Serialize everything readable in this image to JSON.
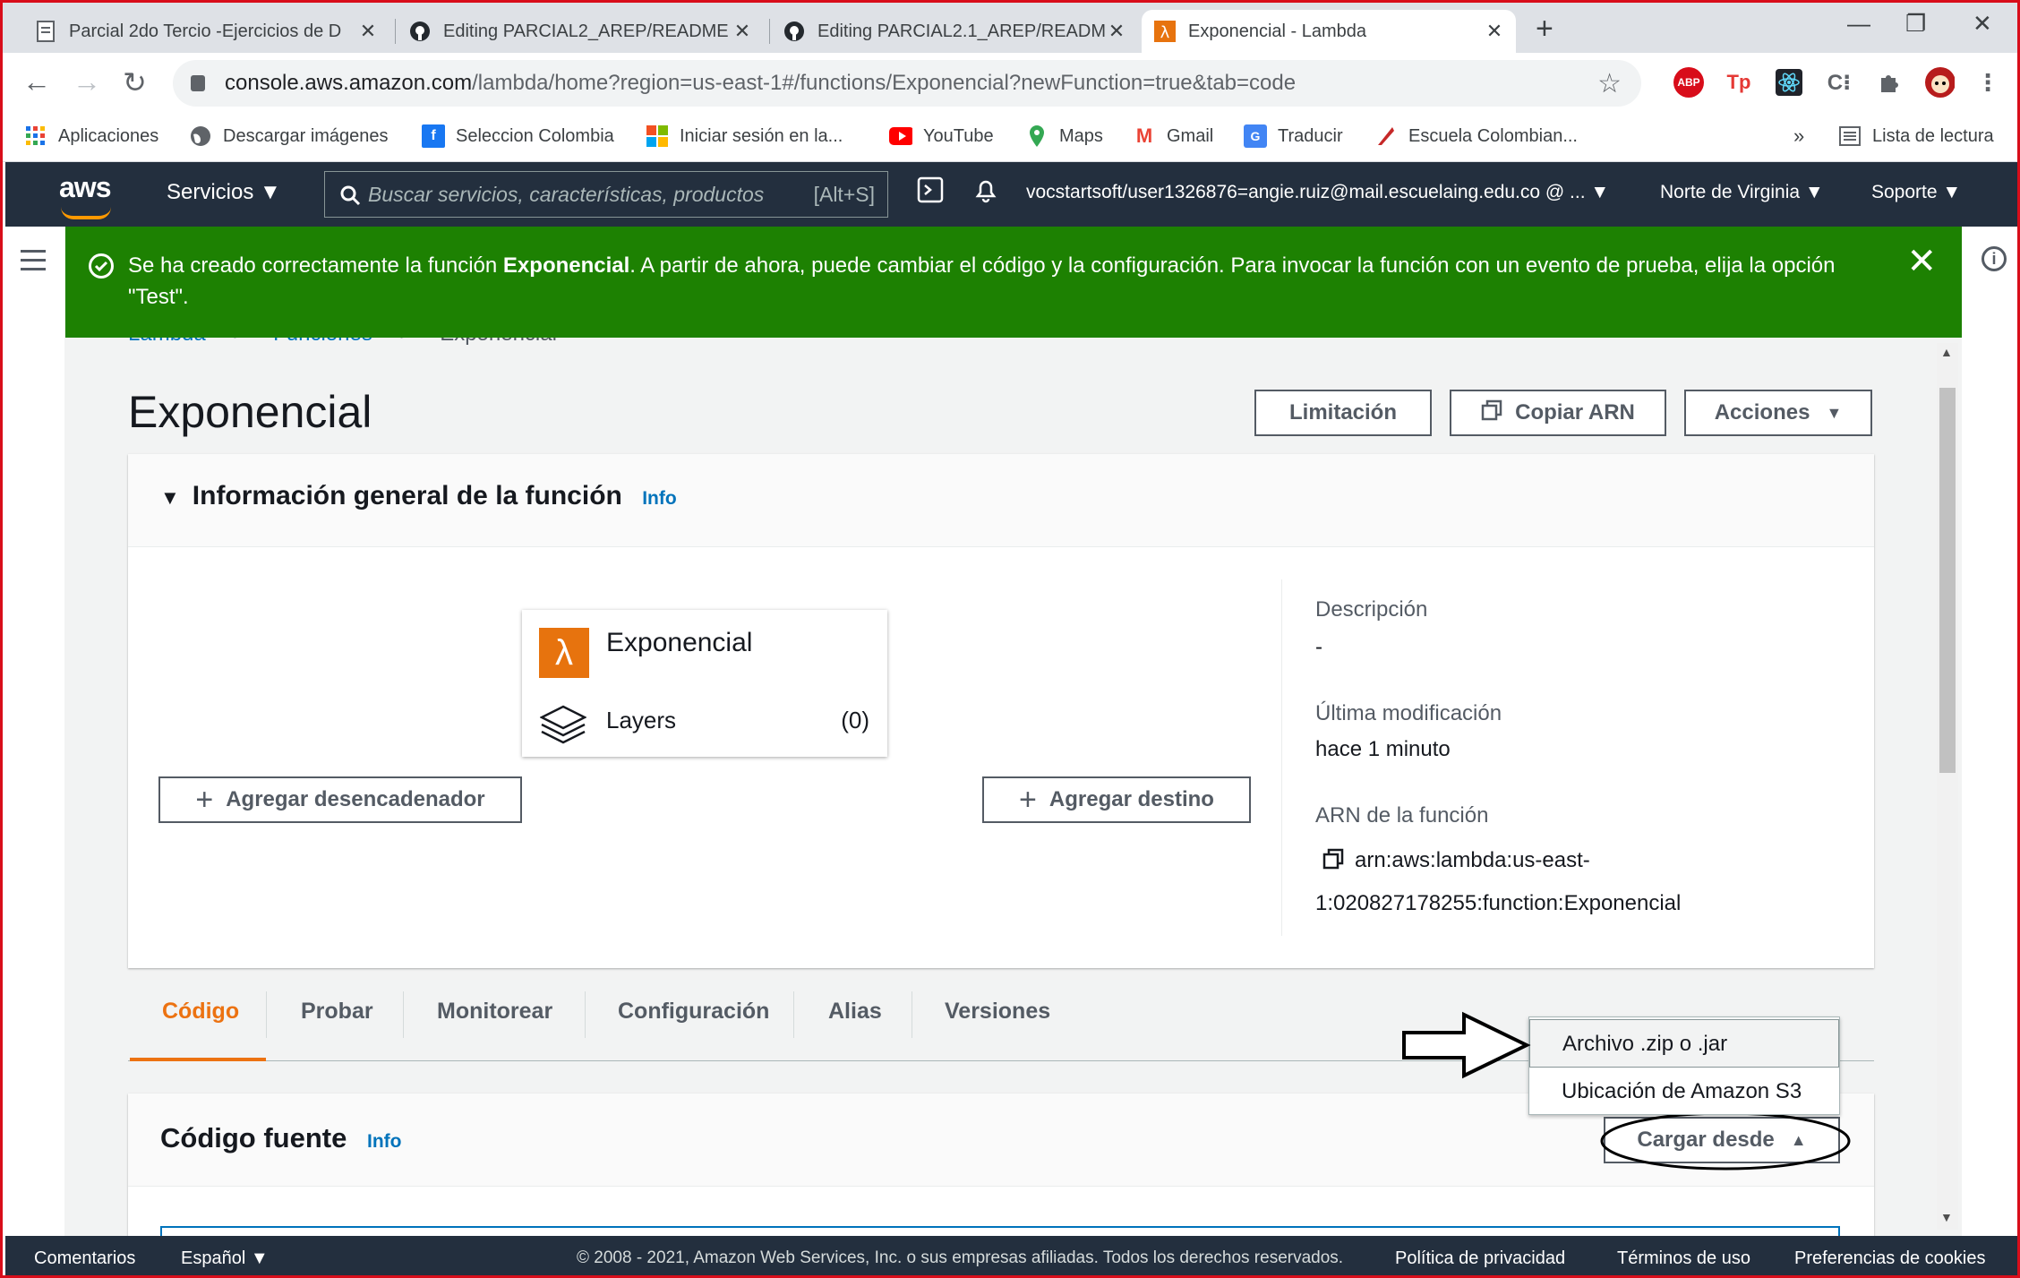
{
  "browser": {
    "tabs": [
      {
        "title": "Parcial 2do Tercio -Ejercicios de D",
        "icon": "document-icon"
      },
      {
        "title": "Editing PARCIAL2_AREP/README",
        "icon": "github-icon"
      },
      {
        "title": "Editing PARCIAL2.1_AREP/READM",
        "icon": "github-icon"
      },
      {
        "title": "Exponencial - Lambda",
        "icon": "lambda-icon"
      }
    ],
    "url_host": "console.aws.amazon.com",
    "url_path": "/lambda/home?region=us-east-1#/functions/Exponencial?newFunction=true&tab=code",
    "extensions": [
      "ABP",
      "Tp"
    ],
    "bookmarks": [
      {
        "label": "Aplicaciones",
        "icon": "apps-grid-icon"
      },
      {
        "label": "Descargar imágenes",
        "icon": "globe-icon"
      },
      {
        "label": "Seleccion Colombia",
        "icon": "facebook-icon"
      },
      {
        "label": "Iniciar sesión en la...",
        "icon": "microsoft-icon"
      },
      {
        "label": "YouTube",
        "icon": "youtube-icon"
      },
      {
        "label": "Maps",
        "icon": "maps-pin-icon"
      },
      {
        "label": "Gmail",
        "icon": "gmail-icon"
      },
      {
        "label": "Traducir",
        "icon": "translate-icon"
      },
      {
        "label": "Escuela Colombian...",
        "icon": "school-icon"
      }
    ],
    "bookmarks_overflow": "»",
    "reading_list": "Lista de lectura"
  },
  "aws_nav": {
    "logo": "aws",
    "services": "Servicios",
    "search_placeholder": "Buscar servicios, características, productos",
    "search_shortcut": "[Alt+S]",
    "account": "vocstartsoft/user1326876=angie.ruiz@mail.escuelaing.edu.co @ ...",
    "region": "Norte de Virginia",
    "support": "Soporte"
  },
  "flash": {
    "text_before": "Se ha creado correctamente la función ",
    "function_name": "Exponencial",
    "text_after": ". A partir de ahora, puede cambiar el código y la configuración. Para invocar la función con un evento de prueba, elija la opción \"Test\"."
  },
  "breadcrumb": [
    "Lambda",
    "Funciones",
    "Exponencial"
  ],
  "page": {
    "title": "Exponencial",
    "buttons": {
      "throttle": "Limitación",
      "copy_arn": "Copiar ARN",
      "actions": "Acciones"
    }
  },
  "overview": {
    "title": "Información general de la función",
    "info": "Info",
    "function_name": "Exponencial",
    "layers_label": "Layers",
    "layers_count": "(0)",
    "add_trigger": "Agregar desencadenador",
    "add_destination": "Agregar destino",
    "description_label": "Descripción",
    "description_value": "-",
    "last_modified_label": "Última modificación",
    "last_modified_value": "hace 1 minuto",
    "arn_label": "ARN de la función",
    "arn_line1": "arn:aws:lambda:us-east-",
    "arn_line2": "1:020827178255:function:Exponencial"
  },
  "tabs": [
    "Código",
    "Probar",
    "Monitorear",
    "Configuración",
    "Alias",
    "Versiones"
  ],
  "source": {
    "title": "Código fuente",
    "info": "Info",
    "upload_from": "Cargar desde",
    "dropdown": [
      "Archivo .zip o .jar",
      "Ubicación de Amazon S3"
    ]
  },
  "footer": {
    "feedback": "Comentarios",
    "language": "Español",
    "copyright": "© 2008 - 2021, Amazon Web Services, Inc. o sus empresas afiliadas. Todos los derechos reservados.",
    "privacy": "Política de privacidad",
    "terms": "Términos de uso",
    "cookies": "Preferencias de cookies"
  },
  "colors": {
    "success": "#1d8102",
    "aws_nav": "#232f3e",
    "accent": "#ec7211",
    "link": "#0073bb"
  }
}
